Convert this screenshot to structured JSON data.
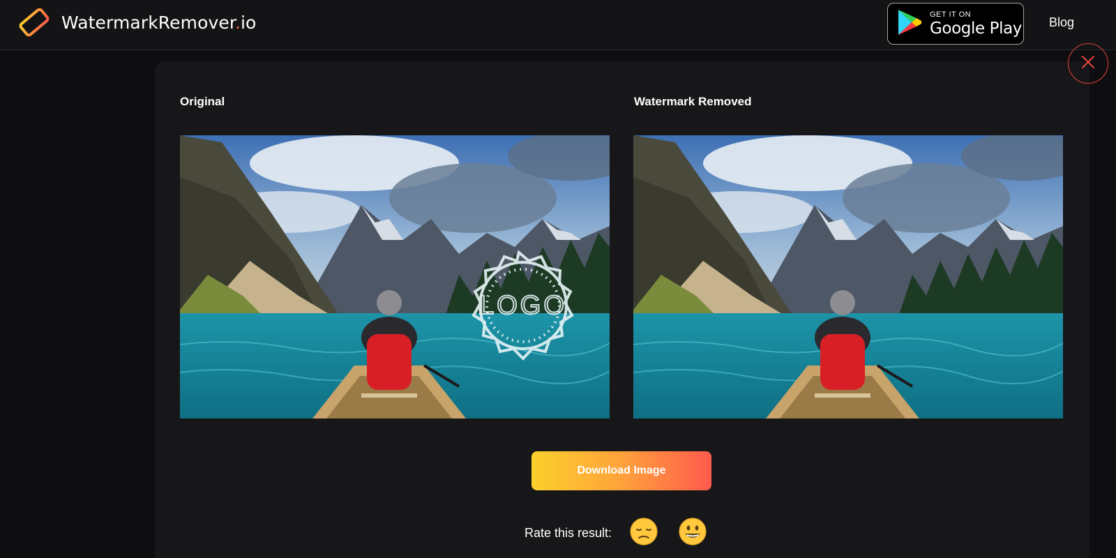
{
  "header": {
    "brand_name": "WatermarkRemover",
    "brand_dot": ".",
    "brand_tld": "io",
    "play_store": {
      "small": "GET IT ON",
      "big": "Google Play"
    },
    "nav": {
      "blog": "Blog"
    }
  },
  "card": {
    "original_label": "Original",
    "removed_label": "Watermark Removed",
    "watermark_text": "LOGO",
    "download_label": "Download Image",
    "rate_label": "Rate this result:"
  },
  "icons": {
    "logo": "eraser-icon",
    "play": "google-play-icon",
    "close": "close-icon",
    "sad": "sad-face-emoji",
    "happy": "grinning-face-emoji"
  },
  "colors": {
    "accent_orange": "#ff6a3d",
    "close_red": "#e0423e",
    "gradient_start": "#fcd02c",
    "gradient_end": "#ff5a4c"
  }
}
